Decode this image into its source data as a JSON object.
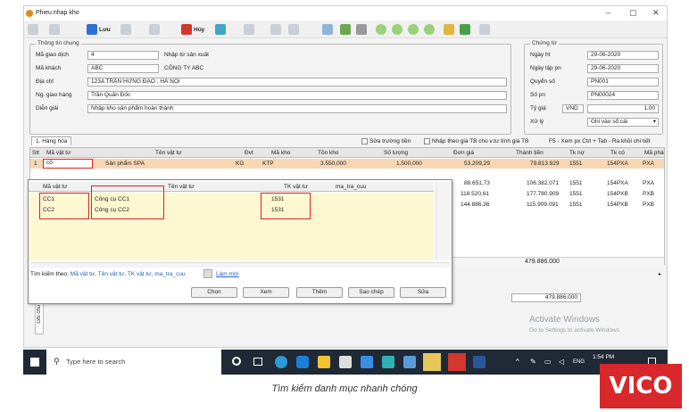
{
  "window": {
    "title": "Phieu nhap kho",
    "min": "–",
    "max": "▢",
    "close": "✕"
  },
  "toolbar": {
    "save": "Lưu",
    "cancel": "Hủy"
  },
  "info": {
    "title": "Thông tin chung",
    "ma_gd_label": "Mã giao dịch",
    "ma_gd": "4",
    "ma_gd_desc": "Nhập từ sản xuất",
    "ma_kh_label": "Mã khách",
    "ma_kh": "ABC",
    "ma_kh_desc": "CÔNG TY ABC",
    "dia_chi_label": "Địa chỉ",
    "dia_chi": "123A TRẦN HƯNG ĐẠO , HÀ NỘI",
    "ng_giao_label": "Ng. giao hàng",
    "ng_giao": "Trần Quản Đốc",
    "dien_giai_label": "Diễn giải",
    "dien_giai": "Nhập kho sản phẩm hoàn thành"
  },
  "voucher": {
    "title": "Chứng từ",
    "ngay_ht_label": "Ngày ht",
    "ngay_ht": "29-06-2020",
    "ngay_lap_label": "Ngày lập pn",
    "ngay_lap": "29-06-2020",
    "quyen_so_label": "Quyển số",
    "quyen_so": "PN001",
    "so_pn_label": "Số pn",
    "so_pn": "PN00024",
    "ty_gia_label": "Tỷ giá",
    "currency": "VND",
    "rate": "1,00",
    "xu_ly_label": "Xử lý",
    "xu_ly": "Ghi vào sổ cái"
  },
  "tabs": {
    "items": "1. Hàng hóa"
  },
  "options": {
    "edit_amount": "Sửa trường tiền",
    "avg_price": "Nhập theo giá TB cho v.tư tính giá TB",
    "hint": "F5 - Xem px    Ctrl + Tab - Ra khỏi chi tiết"
  },
  "grid": {
    "headers": [
      "Stt",
      "Mã vật tư",
      "Tên vật tư",
      "Đvt",
      "Mã kho",
      "Tồn kho",
      "Số lượng",
      "Đơn giá",
      "Thành tiền",
      "Tk nợ",
      "Tk có",
      "Mã phá"
    ],
    "first_row": {
      "stt": "1",
      "ma_vt": "cô",
      "ten_vt": "Sản phẩm SPA",
      "dvt": "KG",
      "ma_kho": "KTP",
      "ton_kho": "3.550,000",
      "so_luong": "1.500,000",
      "don_gia": "53.209,29",
      "thanh_tien": "79.813.929",
      "tk_no": "1551",
      "tk_co": "154PXA",
      "ma_pha": "PXA"
    },
    "rows": [
      {
        "don_gia": "88.651,73",
        "thanh_tien": "106.382.071",
        "tk_no": "1551",
        "tk_co": "154PXA",
        "ma_pha": "PXA"
      },
      {
        "don_gia": "118.520,61",
        "thanh_tien": "177.780.909",
        "tk_no": "1551",
        "tk_co": "154PXB",
        "ma_pha": "PXB"
      },
      {
        "don_gia": "144.886,36",
        "thanh_tien": "115.909.091",
        "tk_no": "1551",
        "tk_co": "154PXB",
        "ma_pha": "PXB"
      }
    ],
    "total": "479.886.000",
    "total_box": "479.886.000"
  },
  "lookup": {
    "headers": [
      "Mã vật tư",
      "Tên vật tư",
      "TK vật tư",
      "ma_tra_cuu"
    ],
    "rows": [
      {
        "ma": "CC1",
        "ten": "Công cụ CC1",
        "tk": "1531"
      },
      {
        "ma": "CC2",
        "ten": "Công cụ CC2",
        "tk": "1531"
      }
    ],
    "search_label": "Tìm kiếm theo:",
    "search_fields": "Mã vật tư, Tên vật tư, TK vật tư, ma_tra_cuu",
    "refresh": "Làm mới",
    "buttons": [
      "Chọn",
      "Xem",
      "Thêm",
      "Sao chép",
      "Sửa"
    ]
  },
  "notes_label": "Ghi chú",
  "watermark": {
    "title": "Activate Windows",
    "sub": "Go to Settings to activate Windows."
  },
  "taskbar": {
    "search": "Type here to search",
    "lang": "ENG",
    "time": "1:54 PM"
  },
  "caption": "Tìm kiếm danh mục nhanh chóng",
  "logo": "VICO"
}
